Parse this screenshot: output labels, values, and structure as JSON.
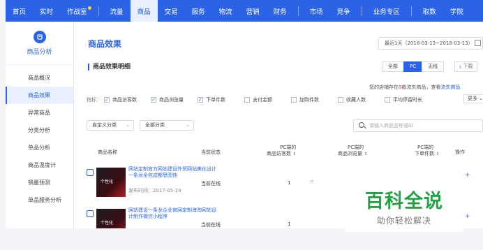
{
  "topnav": {
    "items": [
      {
        "label": "首页"
      },
      {
        "label": "实时"
      },
      {
        "label": "作战室"
      },
      {
        "label": "流量"
      },
      {
        "label": "商品"
      },
      {
        "label": "交易"
      },
      {
        "label": "服务"
      },
      {
        "label": "物流"
      },
      {
        "label": "营销"
      },
      {
        "label": "财务"
      },
      {
        "label": "市场"
      },
      {
        "label": "竞争"
      },
      {
        "label": "业务专区"
      },
      {
        "label": "取数"
      },
      {
        "label": "学院"
      }
    ],
    "active": "商品",
    "accent": "#2a63e6"
  },
  "sidebar": {
    "title": "商品分析",
    "icon": "circle-doc-icon",
    "items": [
      {
        "label": "商品概况"
      },
      {
        "label": "商品效果"
      },
      {
        "label": "异常商品"
      },
      {
        "label": "分类分析"
      },
      {
        "label": "单品分析"
      },
      {
        "label": "商品温度计"
      },
      {
        "label": "销量预测"
      },
      {
        "label": "单品服务分析"
      }
    ],
    "active": "商品效果"
  },
  "main": {
    "title": "商品效果",
    "date_range": "最近1天（2018-03-13~2018-03-13）",
    "section_title": "商品效果明细",
    "segments": [
      "全部",
      "PC",
      "无线"
    ],
    "active_segment": "PC",
    "download_label": "下载",
    "notice": {
      "prefix": "您的店铺存在",
      "count": "0",
      "middle": "款流失商品，查看",
      "link": "流失商品"
    },
    "metrics_label": "指标：",
    "metrics": [
      {
        "label": "商品访客数",
        "checked": true
      },
      {
        "label": "商品浏览量",
        "checked": true
      },
      {
        "label": "下单件数",
        "checked": true
      },
      {
        "label": "支付金额",
        "checked": false
      },
      {
        "label": "加购件数",
        "checked": false
      },
      {
        "label": "收藏人数",
        "checked": false
      },
      {
        "label": "平均停留时长",
        "checked": false
      }
    ],
    "more_label": "更多",
    "filter_custom": "自定义分类",
    "filter_all": "全部分类",
    "search_placeholder": "请输入商品名称或ID",
    "columns": {
      "name": "商品名称",
      "status": "当前状态",
      "visitors_l1": "PC端的",
      "visitors_l2": "商品访客数",
      "views_l1": "PC端的",
      "views_l2": "商品浏览量",
      "orders_l1": "PC端的",
      "orders_l2": "下单件数",
      "action": "操作"
    },
    "rows": [
      {
        "name": "网站定制官方网站建设外贸网站美化设计一条龙全包成都思图佳",
        "time": "发布时间：2017-05-24",
        "status": "当前在线",
        "visitors": "1",
        "thumb_text": "个性化"
      },
      {
        "name": "网站建设一条龙企业官网定制海淘网站设计制作微信小程序",
        "time": "",
        "status": "当前在线",
        "visitors": "1",
        "thumb_text": "个性化"
      }
    ]
  },
  "watermark": {
    "big": "百科全说",
    "small": "助你轻松解决"
  }
}
